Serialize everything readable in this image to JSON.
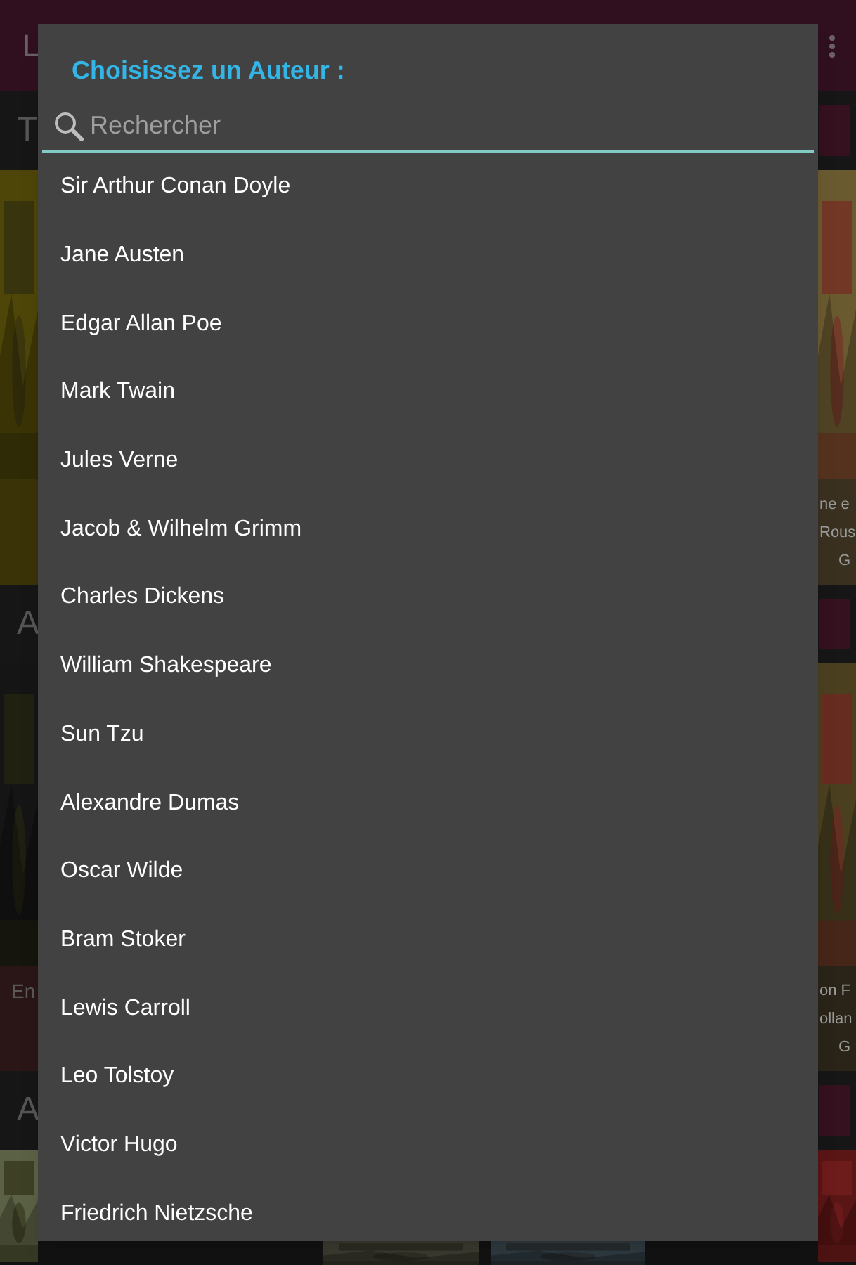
{
  "background": {
    "app_title": "L",
    "sections": [
      {
        "heading": "T",
        "right_caption": [
          "ne e",
          "Rous",
          "G"
        ]
      },
      {
        "heading": "A",
        "left_caption": [
          "En"
        ],
        "right_caption": [
          "on F",
          "ollan",
          "G"
        ]
      },
      {
        "heading": "A"
      }
    ]
  },
  "dialog": {
    "title": "Choisissez un Auteur :",
    "search": {
      "placeholder": "Rechercher"
    },
    "authors": [
      "Sir Arthur Conan Doyle",
      "Jane Austen",
      "Edgar Allan Poe",
      "Mark Twain",
      "Jules Verne",
      "Jacob & Wilhelm Grimm",
      "Charles Dickens",
      "William Shakespeare",
      "Sun Tzu",
      "Alexandre Dumas",
      "Oscar Wilde",
      "Bram Stoker",
      "Lewis Carroll",
      "Leo Tolstoy",
      "Victor Hugo",
      "Friedrich Nietzsche"
    ]
  }
}
